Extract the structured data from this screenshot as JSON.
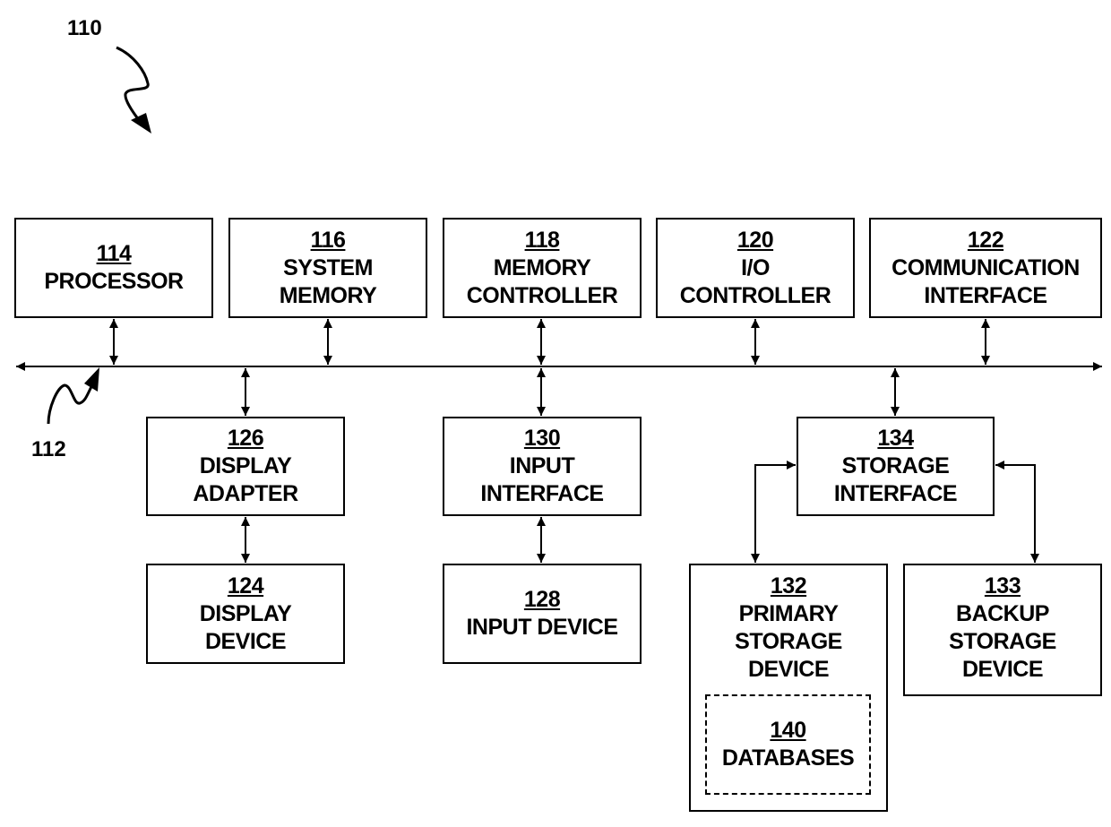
{
  "figure": {
    "reference": "110",
    "bus_reference": "112"
  },
  "blocks": {
    "processor": {
      "ref": "114",
      "label": "PROCESSOR"
    },
    "system_memory": {
      "ref": "116",
      "label": "SYSTEM\nMEMORY"
    },
    "memory_controller": {
      "ref": "118",
      "label": "MEMORY\nCONTROLLER"
    },
    "io_controller": {
      "ref": "120",
      "label": "I/O\nCONTROLLER"
    },
    "communication_interface": {
      "ref": "122",
      "label": "COMMUNICATION\nINTERFACE"
    },
    "display_adapter": {
      "ref": "126",
      "label": "DISPLAY\nADAPTER"
    },
    "display_device": {
      "ref": "124",
      "label": "DISPLAY\nDEVICE"
    },
    "input_interface": {
      "ref": "130",
      "label": "INPUT\nINTERFACE"
    },
    "input_device": {
      "ref": "128",
      "label": "INPUT DEVICE"
    },
    "storage_interface": {
      "ref": "134",
      "label": "STORAGE\nINTERFACE"
    },
    "primary_storage": {
      "ref": "132",
      "label": "PRIMARY\nSTORAGE\nDEVICE"
    },
    "backup_storage": {
      "ref": "133",
      "label": "BACKUP\nSTORAGE\nDEVICE"
    },
    "databases": {
      "ref": "140",
      "label": "DATABASES"
    }
  },
  "connections": [
    [
      "processor",
      "bus"
    ],
    [
      "system_memory",
      "bus"
    ],
    [
      "memory_controller",
      "bus"
    ],
    [
      "io_controller",
      "bus"
    ],
    [
      "communication_interface",
      "bus"
    ],
    [
      "bus",
      "display_adapter"
    ],
    [
      "display_adapter",
      "display_device"
    ],
    [
      "bus",
      "input_interface"
    ],
    [
      "input_interface",
      "input_device"
    ],
    [
      "bus",
      "storage_interface"
    ],
    [
      "storage_interface",
      "primary_storage"
    ],
    [
      "storage_interface",
      "backup_storage"
    ]
  ]
}
